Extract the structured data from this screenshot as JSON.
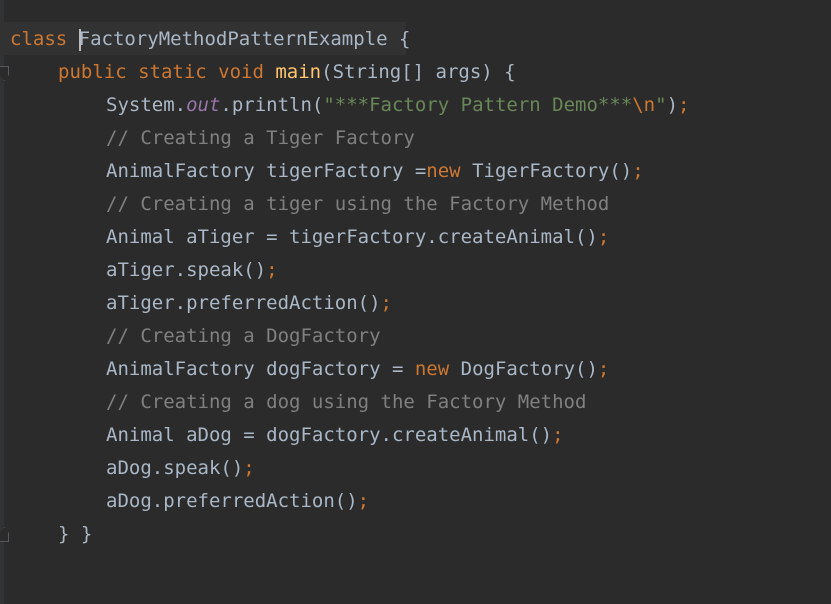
{
  "code": {
    "class_keyword": "class",
    "class_name": "FactoryMethodPatternExample",
    "open_brace": " {",
    "main_modifiers": "public static void",
    "main_name": "main",
    "main_params": "(String[] args) {",
    "sysout_prefix": "System.",
    "sysout_field": "out",
    "sysout_method": ".println(",
    "sysout_string": "\"***Factory Pattern Demo***",
    "sysout_escape": "\\n",
    "sysout_string_end": "\"",
    "sysout_close": ")",
    "semicolon": ";",
    "comment_tiger_factory": "// Creating a Tiger Factory",
    "tiger_factory_decl": "AnimalFactory tigerFactory =",
    "new_keyword": "new",
    "tiger_factory_ctor": " TigerFactory()",
    "comment_tiger_method": "// Creating a tiger using the Factory Method",
    "tiger_decl": "Animal aTiger = tigerFactory.createAnimal()",
    "tiger_speak": "aTiger.speak()",
    "tiger_action": "aTiger.preferredAction()",
    "comment_dog_factory": "// Creating a DogFactory",
    "dog_factory_decl": "AnimalFactory dogFactory = ",
    "dog_factory_ctor": " DogFactory()",
    "comment_dog_method": "// Creating a dog using the Factory Method",
    "dog_decl": "Animal aDog = dogFactory.createAnimal()",
    "dog_speak": "aDog.speak()",
    "dog_action": "aDog.preferredAction()",
    "closing_braces": "} }"
  }
}
